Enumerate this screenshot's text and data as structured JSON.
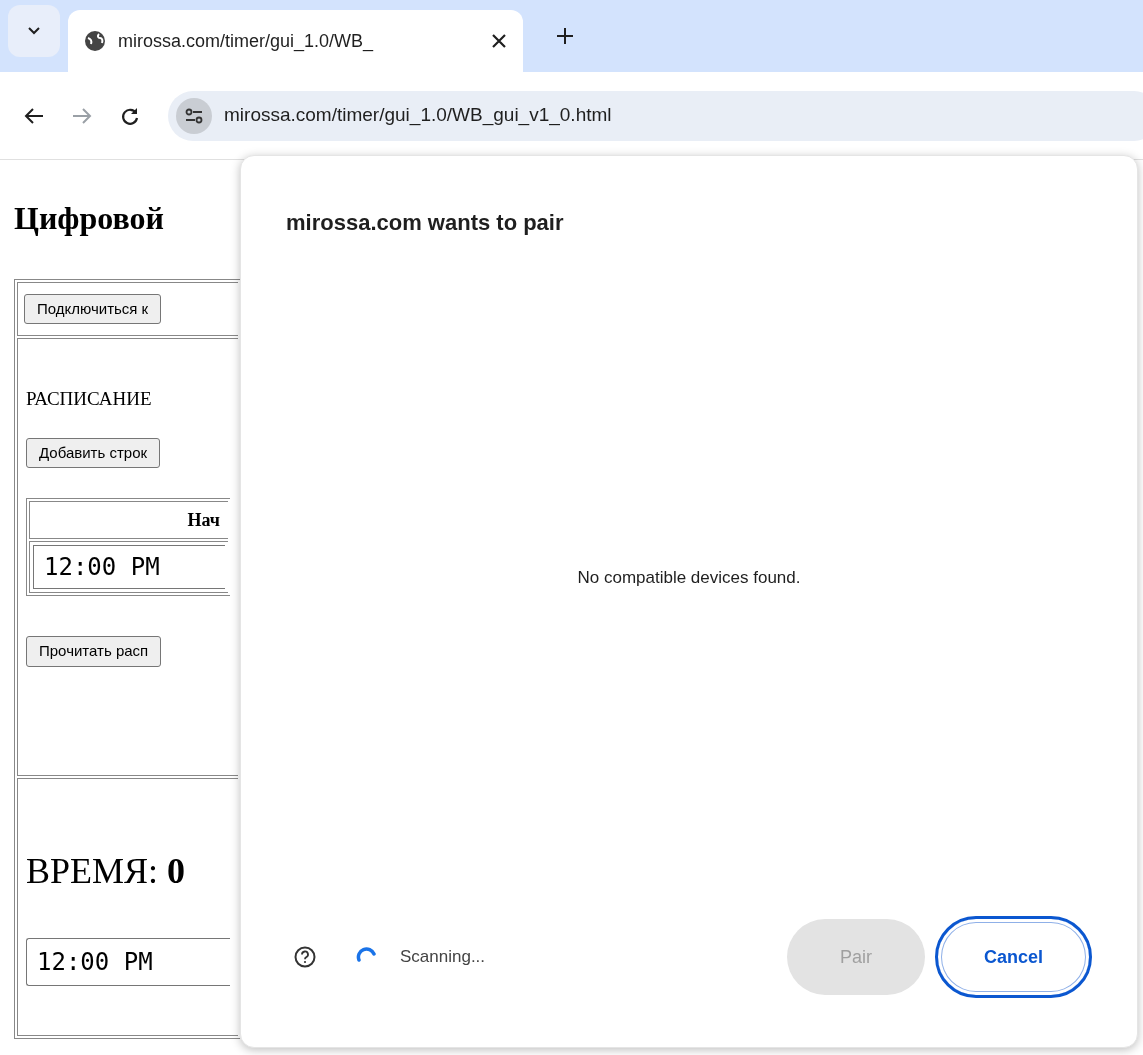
{
  "browser": {
    "tab": {
      "title": "mirossa.com/timer/gui_1.0/WB_"
    },
    "address": "mirossa.com/timer/gui_1.0/WB_gui_v1_0.html"
  },
  "page": {
    "heading": "Цифровой",
    "connect_button": "Подключиться к",
    "schedule_label": "РАСПИСАНИЕ",
    "add_row_button": "Добавить строк",
    "table": {
      "column_1": "Нач",
      "rows": [
        {
          "start": "12:00 PM"
        }
      ]
    },
    "read_button": "Прочитать расп",
    "time_label": "ВРЕМЯ: **0**",
    "time_field": "12:00 PM"
  },
  "dialog": {
    "title": "mirossa.com wants to pair",
    "message": "No compatible devices found.",
    "status": "Scanning...",
    "buttons": [
      {
        "label": "Pair",
        "disabled": true
      },
      {
        "label": "Cancel",
        "disabled": false
      }
    ]
  }
}
